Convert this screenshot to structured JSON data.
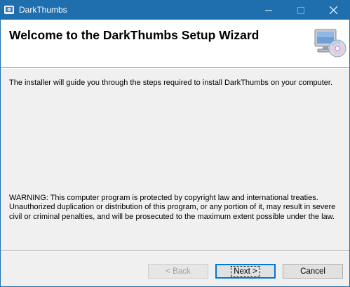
{
  "window": {
    "title": "DarkThumbs",
    "controls": {
      "minimize": "—",
      "maximize": "☐",
      "close": "✕"
    }
  },
  "banner": {
    "title": "Welcome to the DarkThumbs Setup Wizard",
    "icon": "computer-cd-icon"
  },
  "body": {
    "intro": "The installer will guide you through the steps required to install DarkThumbs on your computer.",
    "warning": "WARNING: This computer program is protected by copyright law and international treaties. Unauthorized duplication or distribution of this program, or any portion of it, may result in severe civil or criminal penalties, and will be prosecuted to the maximum extent possible under the law."
  },
  "buttons": {
    "back": "< Back",
    "next": "Next >",
    "cancel": "Cancel"
  },
  "colors": {
    "titlebar": "#1f6fae",
    "focus": "#0078d7"
  }
}
